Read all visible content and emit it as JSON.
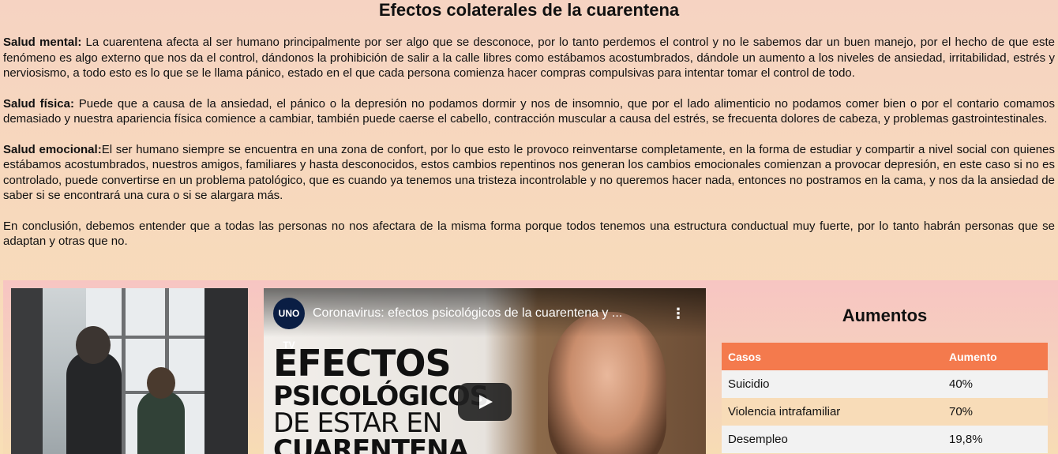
{
  "title": "Efectos colaterales de la cuarentena",
  "paragraphs": [
    {
      "label": "Salud mental:",
      "text": " La cuarentena afecta al ser humano principalmente por ser algo que se desconoce, por lo tanto perdemos el control y no le sabemos dar un buen manejo, por el hecho de que este fenómeno es algo externo que nos da el control, dándonos la prohibición de salir a la calle libres como estábamos acostumbrados, dándole un aumento a los niveles de ansiedad, irritabilidad, estrés y nerviosismo, a todo esto es lo que se le llama pánico, estado en el que cada persona comienza hacer compras compulsivas para intentar tomar el control de todo."
    },
    {
      "label": "Salud física:",
      "text": " Puede que a causa de la ansiedad, el pánico o la depresión no podamos dormir y nos de insomnio, que por el lado alimenticio no podamos comer bien o por el contario comamos demasiado y nuestra apariencia física comience a cambiar, también puede caerse el cabello, contracción muscular a causa del estrés, se frecuenta dolores de cabeza, y problemas gastrointestinales."
    },
    {
      "label": "Salud emocional:",
      "text": "El ser humano siempre se encuentra en una zona de confort, por lo que esto le provoco reinventarse completamente, en la forma de estudiar y compartir a nivel social con quienes estábamos acostumbrados, nuestros amigos, familiares y hasta desconocidos, estos cambios repentinos nos generan los cambios emocionales comienzan a provocar depresión, en este caso si no es controlado, puede convertirse en un problema patológico, que es cuando ya tenemos una tristeza incontrolable y no queremos hacer nada, entonces no postramos en la cama, y nos da la ansiedad de saber si se encontrará una cura o si se alargara más."
    },
    {
      "label": "",
      "text": "En conclusión, debemos entender que a todas las personas no nos afectara de la misma forma porque todos tenemos una estructura conductual muy fuerte, por lo tanto habrán personas que se adaptan y otras que no."
    }
  ],
  "video": {
    "channel_logo": "UNO TV",
    "title": "Coronavirus: efectos psicológicos de la cuarentena y ...",
    "menu_icon": "more-vert-icon",
    "play_icon": "play-icon",
    "thumb_line1": "EFECTOS",
    "thumb_line2": "PSICOLÓGICOS",
    "thumb_line3": "DE ESTAR EN",
    "thumb_line4": "CUARENTENA"
  },
  "table": {
    "title": "Aumentos",
    "headers": [
      "Casos",
      "Aumento"
    ],
    "rows": [
      {
        "caso": "Suicidio",
        "aumento": "40%"
      },
      {
        "caso": "Violencia intrafamiliar",
        "aumento": "70%"
      },
      {
        "caso": "Desempleo",
        "aumento": "19,8%"
      }
    ]
  },
  "colors": {
    "table_header": "#f47a4d",
    "row_light": "#f2f2f2",
    "row_warm": "#f8dcb8"
  }
}
